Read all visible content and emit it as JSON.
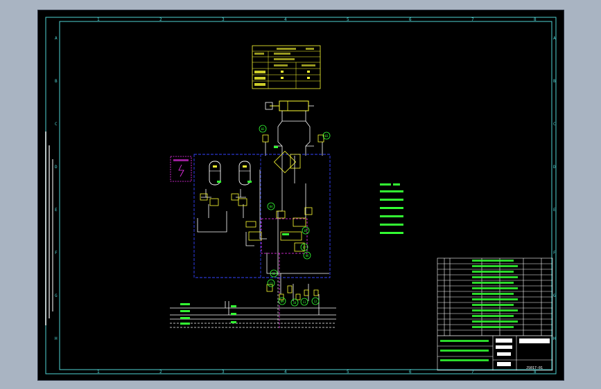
{
  "diagram": {
    "zone_numbers_top": [
      "1",
      "2",
      "3",
      "4",
      "5",
      "6",
      "7",
      "8"
    ],
    "zone_numbers_bottom": [
      "1",
      "2",
      "3",
      "4",
      "5",
      "6",
      "7",
      "8"
    ],
    "zone_letters": [
      "A",
      "B",
      "C",
      "D",
      "E",
      "F",
      "G",
      "H"
    ],
    "component_numbers": [
      "02",
      "03",
      "04",
      "05",
      "06",
      "07",
      "08",
      "09",
      "10",
      "11",
      "12",
      "13"
    ],
    "title_block": {
      "drawing_no": "JS017-01"
    },
    "colors": {
      "frame": "#4fd3d3",
      "circuit": "#ffffff",
      "component": "#ffff33",
      "number": "#33ff33",
      "dashed_box": "#3344ff",
      "magenta": "#ff33ff",
      "background": "#000000"
    }
  }
}
